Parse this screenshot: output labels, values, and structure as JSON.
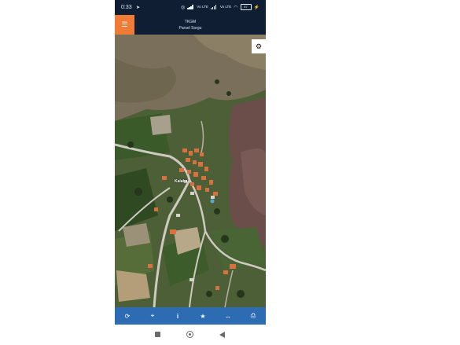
{
  "status_bar": {
    "time": "0:33",
    "play_glyph": "➤",
    "network_labels": [
      "Vo LTE",
      "Vo LTE"
    ],
    "battery": "87",
    "icons": [
      "sync-circle-icon",
      "signal-icon",
      "signal-icon",
      "wifi-icon",
      "battery-icon",
      "charging-icon"
    ]
  },
  "app_bar": {
    "title": "TKGM",
    "subtitle": "Parsel Sorgu",
    "menu_icon": "hamburger-menu-icon"
  },
  "map": {
    "village_label": "Kalaba",
    "settings_icon": "gear-icon"
  },
  "toolbar": {
    "icons": [
      "refresh-icon",
      "locate-icon",
      "info-icon",
      "star-icon",
      "measure-icon",
      "print-icon"
    ]
  },
  "navbar": {
    "icons": [
      "recent-apps-icon",
      "home-icon",
      "back-icon"
    ]
  },
  "colors": {
    "status_bar": "#0f1e33",
    "menu_button": "#f07b36",
    "toolbar": "#2d6cb2"
  }
}
